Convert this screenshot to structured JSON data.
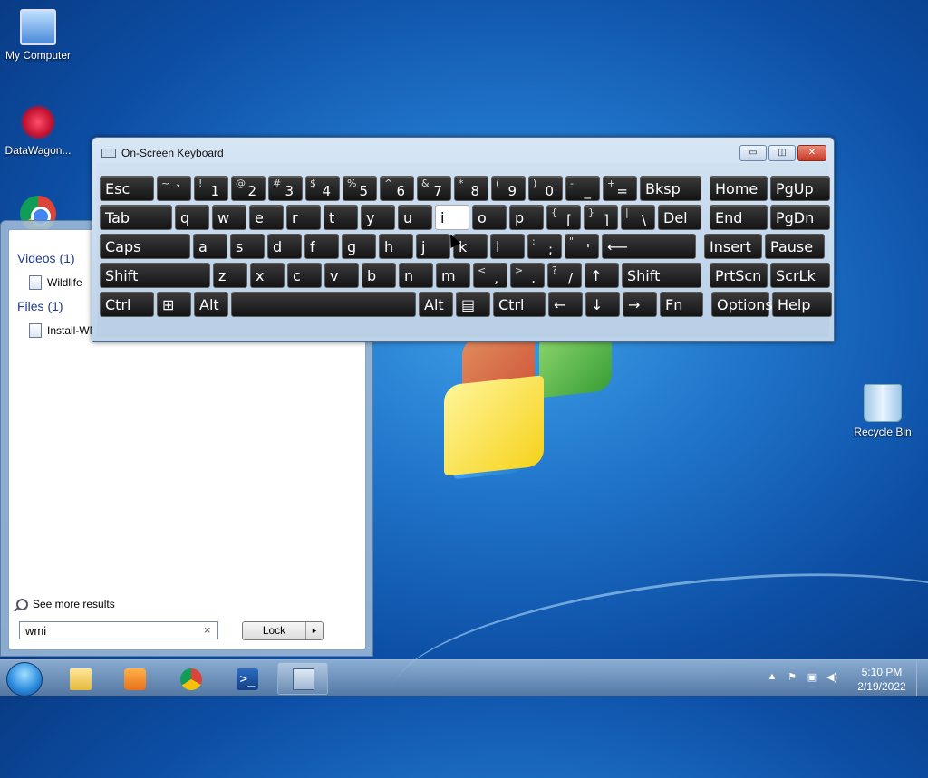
{
  "desktop": {
    "icons": [
      {
        "label": "My Computer",
        "icon": "computer-icon"
      },
      {
        "label": "DataWagon...",
        "icon": "datawagon-icon"
      },
      {
        "label": "",
        "icon": "chrome-icon"
      },
      {
        "label": "Recycle Bin",
        "icon": "recycle-bin-icon"
      }
    ]
  },
  "start_menu": {
    "categories": [
      {
        "title": "Videos (1)",
        "items": [
          "Wildlife"
        ]
      },
      {
        "title": "Files (1)",
        "items": [
          "Install-WN"
        ]
      }
    ],
    "see_more": "See more results",
    "search_value": "wmi",
    "clear_glyph": "×",
    "lock_label": "Lock",
    "lock_arrow": "▸"
  },
  "osk": {
    "title": "On-Screen Keyboard",
    "window_buttons": {
      "minimize": "▭",
      "restore": "◫",
      "close": "✕"
    },
    "rows": [
      [
        {
          "p": "Esc",
          "w": 60
        },
        {
          "s": "~",
          "p": "`",
          "w": 38
        },
        {
          "s": "!",
          "p": "1",
          "w": 38
        },
        {
          "s": "@",
          "p": "2",
          "w": 38
        },
        {
          "s": "#",
          "p": "3",
          "w": 38
        },
        {
          "s": "$",
          "p": "4",
          "w": 38
        },
        {
          "s": "%",
          "p": "5",
          "w": 38
        },
        {
          "s": "^",
          "p": "6",
          "w": 38
        },
        {
          "s": "&",
          "p": "7",
          "w": 38
        },
        {
          "s": "*",
          "p": "8",
          "w": 38
        },
        {
          "s": "(",
          "p": "9",
          "w": 38
        },
        {
          "s": ")",
          "p": "0",
          "w": 38
        },
        {
          "s": "-",
          "p": "_",
          "w": 38
        },
        {
          "s": "+",
          "p": "=",
          "w": 38
        },
        {
          "p": "Bksp",
          "w": 68
        },
        {
          "p": "Home",
          "w": 64,
          "gap": 6
        },
        {
          "p": "PgUp",
          "w": 66
        }
      ],
      [
        {
          "p": "Tab",
          "w": 80
        },
        {
          "p": "q",
          "w": 38
        },
        {
          "p": "w",
          "w": 38
        },
        {
          "p": "e",
          "w": 38
        },
        {
          "p": "r",
          "w": 38
        },
        {
          "p": "t",
          "w": 38
        },
        {
          "p": "y",
          "w": 38
        },
        {
          "p": "u",
          "w": 38
        },
        {
          "p": "i",
          "w": 38,
          "hl": true
        },
        {
          "p": "o",
          "w": 38
        },
        {
          "p": "p",
          "w": 38
        },
        {
          "s": "{",
          "p": "[",
          "w": 38
        },
        {
          "s": "}",
          "p": "]",
          "w": 38
        },
        {
          "s": "|",
          "p": "\\",
          "w": 38
        },
        {
          "p": "Del",
          "w": 48
        },
        {
          "p": "End",
          "w": 64,
          "gap": 6
        },
        {
          "p": "PgDn",
          "w": 66
        }
      ],
      [
        {
          "p": "Caps",
          "w": 100
        },
        {
          "p": "a",
          "w": 38
        },
        {
          "p": "s",
          "w": 38
        },
        {
          "p": "d",
          "w": 38
        },
        {
          "p": "f",
          "w": 38
        },
        {
          "p": "g",
          "w": 38
        },
        {
          "p": "h",
          "w": 38
        },
        {
          "p": "j",
          "w": 38
        },
        {
          "p": "k",
          "w": 38
        },
        {
          "p": "l",
          "w": 38
        },
        {
          "s": ":",
          "p": ";",
          "w": 38
        },
        {
          "s": "\"",
          "p": "'",
          "w": 38
        },
        {
          "p": "⟵",
          "w": 104
        },
        {
          "p": "Insert",
          "w": 64,
          "gap": 6
        },
        {
          "p": "Pause",
          "w": 66
        }
      ],
      [
        {
          "p": "Shift",
          "w": 122
        },
        {
          "p": "z",
          "w": 38
        },
        {
          "p": "x",
          "w": 38
        },
        {
          "p": "c",
          "w": 38
        },
        {
          "p": "v",
          "w": 38
        },
        {
          "p": "b",
          "w": 38
        },
        {
          "p": "n",
          "w": 38
        },
        {
          "p": "m",
          "w": 38
        },
        {
          "s": "<",
          "p": ",",
          "w": 38
        },
        {
          "s": ">",
          "p": ".",
          "w": 38
        },
        {
          "s": "?",
          "p": "/",
          "w": 38
        },
        {
          "p": "↑",
          "w": 38
        },
        {
          "p": "Shift",
          "w": 88
        },
        {
          "p": "PrtScn",
          "w": 64,
          "gap": 6
        },
        {
          "p": "ScrLk",
          "w": 66
        }
      ],
      [
        {
          "p": "Ctrl",
          "w": 60
        },
        {
          "p": "⊞",
          "w": 38
        },
        {
          "p": "Alt",
          "w": 38
        },
        {
          "p": "",
          "w": 204
        },
        {
          "p": "Alt",
          "w": 38
        },
        {
          "p": "▤",
          "w": 38
        },
        {
          "p": "Ctrl",
          "w": 58
        },
        {
          "p": "←",
          "w": 38
        },
        {
          "p": "↓",
          "w": 38
        },
        {
          "p": "→",
          "w": 38
        },
        {
          "p": "Fn",
          "w": 48
        },
        {
          "p": "Options",
          "w": 64,
          "gap": 6
        },
        {
          "p": "Help",
          "w": 66
        }
      ]
    ]
  },
  "taskbar": {
    "apps": [
      {
        "name": "explorer",
        "icon": "folder-icon"
      },
      {
        "name": "media-player",
        "icon": "media-player-icon"
      },
      {
        "name": "chrome",
        "icon": "chrome-icon"
      },
      {
        "name": "powershell",
        "icon": "powershell-icon",
        "glyph": ">_"
      },
      {
        "name": "on-screen-keyboard",
        "icon": "keyboard-icon",
        "active": true
      }
    ],
    "tray": {
      "up": "▲",
      "flag": "⚑",
      "network": "▣",
      "volume": "◀)"
    },
    "time": "5:10 PM",
    "date": "2/19/2022"
  }
}
